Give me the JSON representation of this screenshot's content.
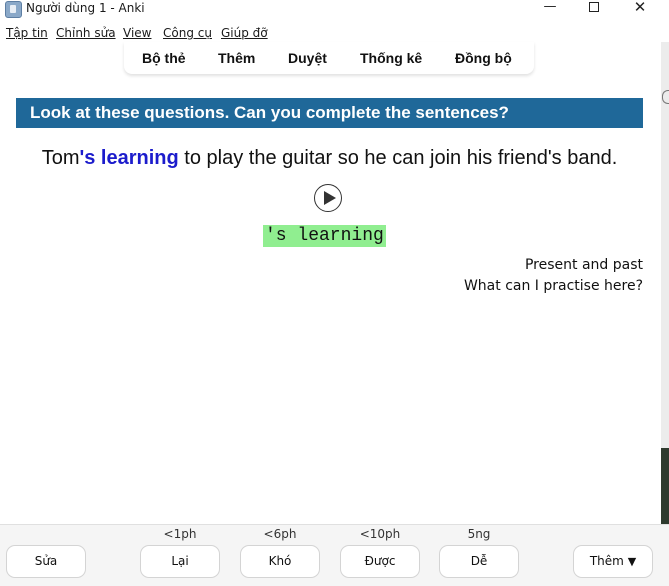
{
  "window": {
    "title": "Người dùng 1 - Anki",
    "minimize": "—",
    "close": "✕"
  },
  "menu": {
    "items": [
      "Tập tin",
      "Chỉnh sửa",
      "View",
      "Công cụ",
      "Giúp đỡ"
    ]
  },
  "toolbar": {
    "tabs": [
      "Bộ thẻ",
      "Thêm",
      "Duyệt",
      "Thống kê",
      "Đồng bộ"
    ]
  },
  "card": {
    "banner": "Look at these questions. Can you complete the sentences?",
    "sentence_before": "Tom",
    "sentence_highlight": "'s learning",
    "sentence_after": " to play the guitar so he can join his friend's band.",
    "answer": "'s learning",
    "unit": "Present and past",
    "practice_link": "What can I practise here?"
  },
  "review": {
    "edit_label": "Sửa",
    "more_label": "Thêm",
    "more_arrow": "▼",
    "answers": [
      {
        "interval": "<1ph",
        "label": "Lại"
      },
      {
        "interval": "<6ph",
        "label": "Khó"
      },
      {
        "interval": "<10ph",
        "label": "Được"
      },
      {
        "interval": "5ng",
        "label": "Dễ"
      }
    ]
  },
  "colors": {
    "banner_bg": "#1f6899",
    "highlight_text": "#1c1ccc",
    "answer_bg": "#90ee90"
  }
}
